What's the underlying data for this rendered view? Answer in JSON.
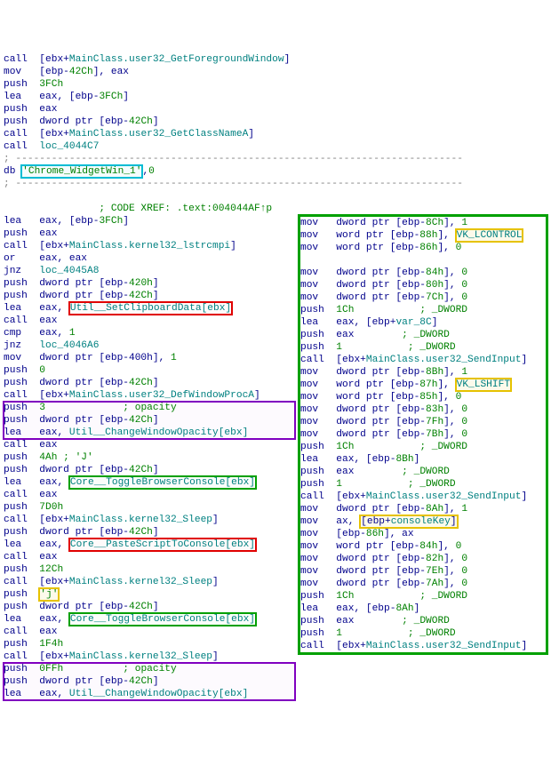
{
  "top": [
    {
      "mn": "call",
      "args": "[ebx+MainClass.user32_GetForegroundWindow]"
    },
    {
      "mn": "mov",
      "args": "[ebp-42Ch], eax"
    },
    {
      "mn": "push",
      "args": "3FCh",
      "numOnly": true
    },
    {
      "mn": "lea",
      "args": "eax, [ebp-3FCh]"
    },
    {
      "mn": "push",
      "args": "eax"
    },
    {
      "mn": "push",
      "args": "dword ptr [ebp-42Ch]"
    },
    {
      "mn": "call",
      "args": "[ebx+MainClass.user32_GetClassNameA]"
    },
    {
      "mn": "call",
      "args": "loc_4044C7"
    }
  ],
  "sep": "; ---------------------------------------------------------------------------",
  "dbLine": {
    "kw": "db",
    "str": "'Chrome_WidgetWin_1'",
    "tail": ","
  },
  "tail0": "0",
  "xref": "; CODE XREF: .text:004044AF↑p",
  "leftA": [
    {
      "mn": "lea",
      "args": "eax, [ebp-3FCh]"
    },
    {
      "mn": "push",
      "args": "eax"
    },
    {
      "mn": "call",
      "args": "[ebx+MainClass.kernel32_lstrcmpi]"
    },
    {
      "mn": "or",
      "args": "eax, eax"
    },
    {
      "mn": "jnz",
      "args": "loc_4045A8"
    },
    {
      "mn": "push",
      "args": "dword ptr [ebp-420h]"
    },
    {
      "mn": "push",
      "args": "dword ptr [ebp-42Ch]"
    }
  ],
  "leaSetClip": {
    "before": "eax, ",
    "hl": "Util__SetClipboardData[ebx]"
  },
  "leftB": [
    {
      "mn": "call",
      "args": "eax"
    },
    {
      "mn": "cmp",
      "args": "eax, 1",
      "mix": true
    },
    {
      "mn": "jnz",
      "args": "loc_4046A6"
    },
    {
      "mn": "mov",
      "args": "dword ptr [ebp-400h], 1",
      "mix": true
    },
    {
      "mn": "push",
      "args": "0",
      "numOnly": true
    },
    {
      "mn": "push",
      "args": "dword ptr [ebp-42Ch]"
    },
    {
      "mn": "call",
      "args": "[ebx+MainClass.user32_DefWindowProcA]"
    }
  ],
  "purple1": {
    "l1": {
      "mn": "push",
      "val": "3",
      "cm": "; opacity"
    },
    "l2": {
      "mn": "push",
      "args": "dword ptr [ebp-42Ch]"
    },
    "l3": {
      "mn": "lea",
      "args": "eax, Util__ChangeWindowOpacity[ebx]"
    }
  },
  "leftC": [
    {
      "mn": "call",
      "args": "eax"
    },
    {
      "mn": "push",
      "args": "4Ah ; 'J'",
      "mix4A": true
    },
    {
      "mn": "push",
      "args": "dword ptr [ebp-42Ch]"
    }
  ],
  "toggle1": {
    "before": "eax, ",
    "hl": "Core__ToggleBrowserConsole[ebx]"
  },
  "leftD": [
    {
      "mn": "call",
      "args": "eax"
    },
    {
      "mn": "push",
      "args": "7D0h",
      "numOnly": true
    },
    {
      "mn": "call",
      "args": "[ebx+MainClass.kernel32_Sleep]"
    },
    {
      "mn": "push",
      "args": "dword ptr [ebp-42Ch]"
    }
  ],
  "paste": {
    "before": "eax, ",
    "hl": "Core__PasteScriptToConsole[ebx]"
  },
  "leftE": [
    {
      "mn": "call",
      "args": "eax"
    },
    {
      "mn": "push",
      "args": "12Ch",
      "numOnly": true
    },
    {
      "mn": "call",
      "args": "[ebx+MainClass.kernel32_Sleep]"
    }
  ],
  "pushJ": {
    "mn": "push",
    "val": "'j'"
  },
  "leftF": [
    {
      "mn": "push",
      "args": "dword ptr [ebp-42Ch]"
    }
  ],
  "toggle2": {
    "before": "eax, ",
    "hl": "Core__ToggleBrowserConsole[ebx]"
  },
  "leftG": [
    {
      "mn": "call",
      "args": "eax"
    },
    {
      "mn": "push",
      "args": "1F4h",
      "numOnly": true
    },
    {
      "mn": "call",
      "args": "[ebx+MainClass.kernel32_Sleep]"
    }
  ],
  "purple2": {
    "l1": {
      "mn": "push",
      "val": "0FFh",
      "cm": "; opacity"
    },
    "l2": {
      "mn": "push",
      "args": "dword ptr [ebp-42Ch]"
    },
    "l3": {
      "mn": "lea",
      "args": "eax, Util__ChangeWindowOpacity[ebx]"
    }
  },
  "right": [
    {
      "mn": "mov",
      "t": "dword ptr [ebp-",
      "off": "8Ch",
      "after": "], ",
      "val": "1"
    },
    {
      "mn": "mov",
      "t": "word ptr [ebp-",
      "off": "88h",
      "after": "], ",
      "hl": "VK_LCONTROL"
    },
    {
      "mn": "mov",
      "t": "word ptr [ebp-",
      "off": "86h",
      "after": "], ",
      "val": "0"
    },
    {
      "blank": true
    },
    {
      "mn": "mov",
      "t": "dword ptr [ebp-",
      "off": "84h",
      "after": "], ",
      "val": "0"
    },
    {
      "mn": "mov",
      "t": "dword ptr [ebp-",
      "off": "80h",
      "after": "], ",
      "val": "0"
    },
    {
      "mn": "mov",
      "t": "dword ptr [ebp-",
      "off": "7Ch",
      "after": "], ",
      "val": "0"
    },
    {
      "mn": "push",
      "val": "1Ch",
      "cm": "; _DWORD"
    },
    {
      "mn": "lea",
      "t": "eax, [ebp+",
      "name": "var_8C",
      "after": "]"
    },
    {
      "mn": "push",
      "t": "eax",
      "cm": "; _DWORD"
    },
    {
      "mn": "push",
      "val": "1",
      "cm": "; _DWORD"
    },
    {
      "mn": "call",
      "t": "[ebx+MainClass.user32_SendInput]"
    },
    {
      "mn": "mov",
      "t": "dword ptr [ebp-",
      "off": "8Bh",
      "after": "], ",
      "val": "1"
    },
    {
      "mn": "mov",
      "t": "word ptr [ebp-",
      "off": "87h",
      "after": "], ",
      "hl": "VK_LSHIFT"
    },
    {
      "mn": "mov",
      "t": "word ptr [ebp-",
      "off": "85h",
      "after": "], ",
      "val": "0"
    },
    {
      "mn": "mov",
      "t": "dword ptr [ebp-",
      "off": "83h",
      "after": "], ",
      "val": "0"
    },
    {
      "mn": "mov",
      "t": "dword ptr [ebp-",
      "off": "7Fh",
      "after": "], ",
      "val": "0"
    },
    {
      "mn": "mov",
      "t": "dword ptr [ebp-",
      "off": "7Bh",
      "after": "], ",
      "val": "0"
    },
    {
      "mn": "push",
      "val": "1Ch",
      "cm": "; _DWORD"
    },
    {
      "mn": "lea",
      "t": "eax, [ebp-",
      "off": "8Bh",
      "after": "]"
    },
    {
      "mn": "push",
      "t": "eax",
      "cm": "; _DWORD"
    },
    {
      "mn": "push",
      "val": "1",
      "cm": "; _DWORD"
    },
    {
      "mn": "call",
      "t": "[ebx+MainClass.user32_SendInput]"
    },
    {
      "mn": "mov",
      "t": "dword ptr [ebp-",
      "off": "8Ah",
      "after": "], ",
      "val": "1"
    },
    {
      "mn": "mov",
      "t": "ax, ",
      "hlbox": "[ebp+consoleKey]"
    },
    {
      "mn": "mov",
      "t": "[ebp-",
      "off": "86h",
      "after": "], ax"
    },
    {
      "mn": "mov",
      "t": "word ptr [ebp-",
      "off": "84h",
      "after": "], ",
      "val": "0"
    },
    {
      "mn": "mov",
      "t": "dword ptr [ebp-",
      "off": "82h",
      "after": "], ",
      "val": "0"
    },
    {
      "mn": "mov",
      "t": "dword ptr [ebp-",
      "off": "7Eh",
      "after": "], ",
      "val": "0"
    },
    {
      "mn": "mov",
      "t": "dword ptr [ebp-",
      "off": "7Ah",
      "after": "], ",
      "val": "0"
    },
    {
      "mn": "push",
      "val": "1Ch",
      "cm": "; _DWORD"
    },
    {
      "mn": "lea",
      "t": "eax, [ebp-",
      "off": "8Ah",
      "after": "]"
    },
    {
      "mn": "push",
      "t": "eax",
      "cm": "; _DWORD"
    },
    {
      "mn": "push",
      "val": "1",
      "cm": "; _DWORD"
    },
    {
      "mn": "call",
      "t": "[ebx+MainClass.user32_SendInput]"
    }
  ]
}
